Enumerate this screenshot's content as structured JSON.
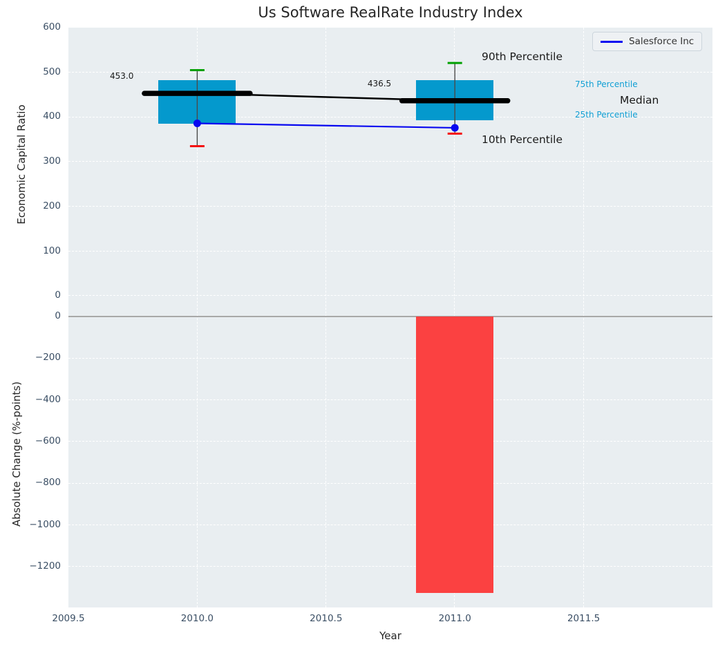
{
  "title": "Us Software RealRate Industry Index",
  "legend": {
    "label": "Salesforce Inc",
    "line_color": "#0808f0"
  },
  "colors": {
    "figure_background": "#ffffff",
    "plot_background": "#e9eef1",
    "grid": "#ffffff",
    "tick_text": "#3a4e64",
    "box_fill": "#0499cd",
    "median_line": "#000000",
    "whisker_line": "#4a4a4a",
    "cap_90th": "#00a000",
    "cap_10th": "#f40f0f",
    "series_line": "#0808f0",
    "bar_fill": "#fb4141",
    "zero_line": "#a8a8a8",
    "percentile_label_cyan": "#109fd4",
    "annotation_black": "#1a1a1a"
  },
  "xaxis": {
    "label": "Year",
    "range": [
      2009.5,
      2012.0
    ],
    "ticks": [
      2009.5,
      2010.0,
      2010.5,
      2011.0,
      2011.5
    ],
    "tick_labels": [
      "2009.5",
      "2010.0",
      "2010.5",
      "2011.0",
      "2011.5"
    ]
  },
  "chart_data": [
    {
      "type": "box",
      "title": "Us Software RealRate Industry Index",
      "ylabel": "Economic Capital Ratio",
      "ylim": [
        -12,
        600
      ],
      "yticks": [
        0,
        100,
        200,
        300,
        400,
        500,
        600
      ],
      "ytick_labels": [
        "0",
        "100",
        "200",
        "300",
        "400",
        "500",
        "600"
      ],
      "grid": true,
      "boxes": [
        {
          "year": 2010,
          "median": 453.0,
          "median_label": "453.0",
          "q25": 385,
          "q75": 483,
          "p10": 335,
          "p90": 505
        },
        {
          "year": 2011,
          "median": 436.5,
          "median_label": "436.5",
          "q25": 393,
          "q75": 483,
          "p10": 363,
          "p90": 521
        }
      ],
      "series": [
        {
          "name": "Salesforce Inc",
          "x": [
            2010,
            2011
          ],
          "y": [
            386,
            376
          ],
          "color": "#0808f0",
          "marker": "circle"
        }
      ],
      "annotations": [
        {
          "text": "90th Percentile",
          "size": "large",
          "color": "#1a1a1a"
        },
        {
          "text": "75th Percentile",
          "size": "small",
          "color": "#109fd4"
        },
        {
          "text": "Median",
          "size": "large",
          "color": "#1a1a1a"
        },
        {
          "text": "25th Percentile",
          "size": "small",
          "color": "#109fd4"
        },
        {
          "text": "10th Percentile",
          "size": "large",
          "color": "#1a1a1a"
        }
      ],
      "legend_position": "top-right"
    },
    {
      "type": "bar",
      "ylabel": "Absolute Change (%-points)",
      "ylim": [
        -1395,
        73
      ],
      "yticks": [
        0,
        -200,
        -400,
        -600,
        -800,
        -1000,
        -1200
      ],
      "ytick_labels": [
        "0",
        "−200",
        "−400",
        "−600",
        "−800",
        "−1000",
        "−1200"
      ],
      "grid": true,
      "bars": [
        {
          "year": 2011,
          "value": -1325
        }
      ],
      "bar_color": "#fb4141"
    }
  ]
}
